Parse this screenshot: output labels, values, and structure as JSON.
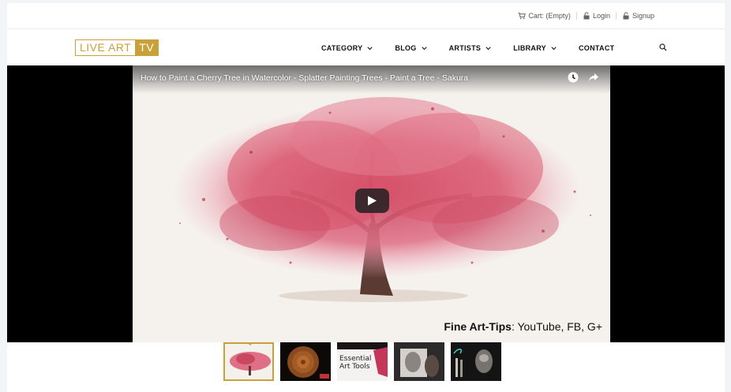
{
  "topbar": {
    "cart": "Cart: (Empty)",
    "login": "Login",
    "signup": "Signup"
  },
  "logo": {
    "part1": "LIVE ART",
    "part2": "TV"
  },
  "nav": {
    "items": [
      {
        "label": "CATEGORY",
        "dropdown": true
      },
      {
        "label": "BLOG",
        "dropdown": true
      },
      {
        "label": "ARTISTS",
        "dropdown": true
      },
      {
        "label": "LIBRARY",
        "dropdown": true
      },
      {
        "label": "CONTACT",
        "dropdown": false
      }
    ]
  },
  "video": {
    "title": "How to Paint a Cherry Tree in Watercolor - Splatter Painting Trees - Paint a Tree - Sakura",
    "watermark_bold": "Fine Art-Tips",
    "watermark_rest": ": YouTube, FB, G+"
  },
  "thumbnails": {
    "items": [
      {
        "name": "cherry-tree",
        "active": true
      },
      {
        "name": "wood-slice",
        "active": false
      },
      {
        "name": "essential-art-tools",
        "text_line1": "Essential",
        "text_line2": "Art Tools",
        "active": false
      },
      {
        "name": "portrait-drawing",
        "active": false
      },
      {
        "name": "art-portraits",
        "active": false
      }
    ]
  },
  "colors": {
    "accent": "#c9a13a",
    "player_bg": "#000000",
    "blossom": "#d9536b"
  }
}
